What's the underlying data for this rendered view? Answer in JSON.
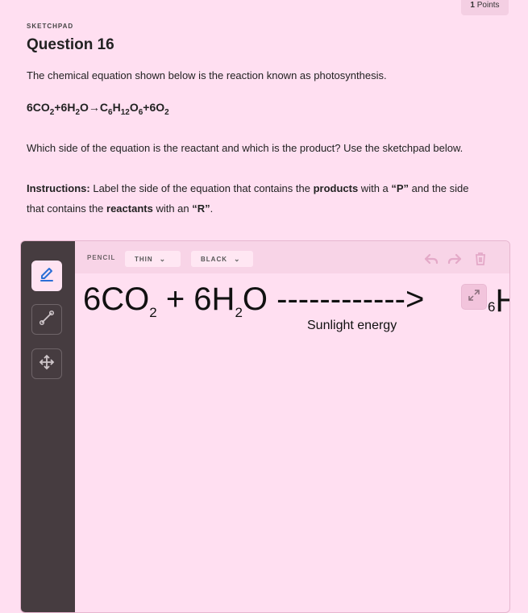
{
  "points": {
    "value": "1",
    "label": "Points"
  },
  "kicker": "SKETCHPAD",
  "question_title": "Question 16",
  "intro": "The chemical equation shown below is the reaction known as photosynthesis.",
  "equation": {
    "p1": "6CO",
    "s1": "2",
    "p2": "+6H",
    "s2": "2",
    "p3": "O",
    "arrow": "→",
    "p4": "C",
    "s3": "6",
    "p5": "H",
    "s4": "12",
    "p6": "O",
    "s5": "6",
    "p7": "+6O",
    "s6": "2"
  },
  "question_text": "Which side of the equation is the reactant and which is the product? Use the sketchpad below.",
  "instructions": {
    "label": "Instructions:",
    "t1": " Label the side of the equation that contains the ",
    "b1": "products",
    "t2": " with a ",
    "b2": "“P”",
    "t3": " and the side that contains the ",
    "b3": "reactants",
    "t4": " with an ",
    "b4": "“R”",
    "t5": "."
  },
  "sketchpad": {
    "tool_label": "PENCIL",
    "thickness": "THIN",
    "color_option": "BLACK",
    "tools": [
      "pencil-icon",
      "line-icon",
      "move-icon"
    ],
    "actions": [
      "undo-icon",
      "redo-icon",
      "trash-icon"
    ],
    "image_equation": {
      "p1": "6CO",
      "s1": "2",
      "p2": " + 6H",
      "s2": "2",
      "p3": "O",
      "arrow": " ------------>",
      "tail_small": "6",
      "tail_big": "H"
    },
    "sunlight_label": "Sunlight energy"
  },
  "colors": {
    "background": "#ffdff1",
    "sidebar": "#463c40",
    "toolbar": "#f8d4e7",
    "accent": "#2b6fd6"
  }
}
